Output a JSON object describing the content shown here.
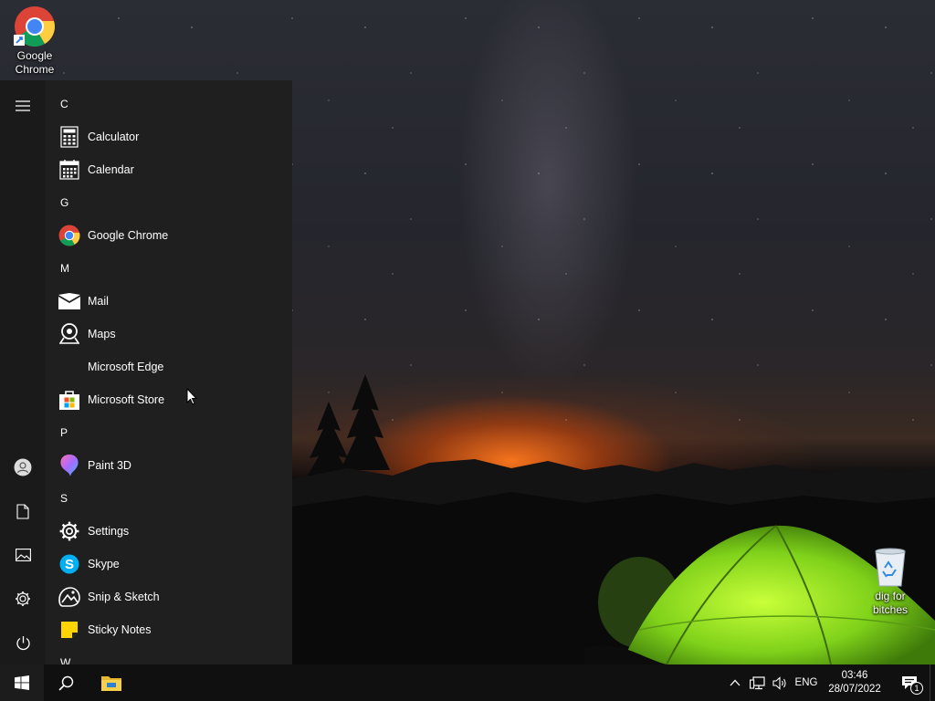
{
  "desktop": {
    "icons": [
      {
        "label": "Google\nChrome",
        "icon": "chrome-icon"
      },
      {
        "label": "dig for\nbitches",
        "icon": "recycle-bin-icon"
      }
    ]
  },
  "start_menu": {
    "rail": [
      {
        "icon": "hamburger-menu-icon"
      },
      {
        "icon": "user-account-icon"
      },
      {
        "icon": "documents-icon"
      },
      {
        "icon": "pictures-icon"
      },
      {
        "icon": "settings-gear-icon"
      },
      {
        "icon": "power-icon"
      }
    ],
    "groups": [
      {
        "letter": "C",
        "apps": [
          {
            "label": "Calculator",
            "icon": "calculator-icon"
          },
          {
            "label": "Calendar",
            "icon": "calendar-icon"
          }
        ]
      },
      {
        "letter": "G",
        "apps": [
          {
            "label": "Google Chrome",
            "icon": "chrome-icon"
          }
        ]
      },
      {
        "letter": "M",
        "apps": [
          {
            "label": "Mail",
            "icon": "mail-icon"
          },
          {
            "label": "Maps",
            "icon": "maps-icon"
          },
          {
            "label": "Microsoft Edge",
            "icon": "edge-icon"
          },
          {
            "label": "Microsoft Store",
            "icon": "store-icon"
          }
        ]
      },
      {
        "letter": "P",
        "apps": [
          {
            "label": "Paint 3D",
            "icon": "paint-3d-icon"
          }
        ]
      },
      {
        "letter": "S",
        "apps": [
          {
            "label": "Settings",
            "icon": "settings-icon"
          },
          {
            "label": "Skype",
            "icon": "skype-icon"
          },
          {
            "label": "Snip & Sketch",
            "icon": "snip-sketch-icon"
          },
          {
            "label": "Sticky Notes",
            "icon": "sticky-notes-icon"
          }
        ]
      },
      {
        "letter": "W",
        "apps": []
      }
    ]
  },
  "taskbar": {
    "start_icon": "windows-logo-icon",
    "search_icon": "search-icon",
    "pinned": [
      {
        "icon": "file-explorer-icon"
      }
    ],
    "tray": {
      "chevron_icon": "chevron-up-icon",
      "network_icon": "network-icon",
      "volume_icon": "volume-icon",
      "language": "ENG",
      "time": "03:46",
      "date": "28/07/2022",
      "notifications_icon": "action-center-icon",
      "notifications_count": "1"
    }
  }
}
